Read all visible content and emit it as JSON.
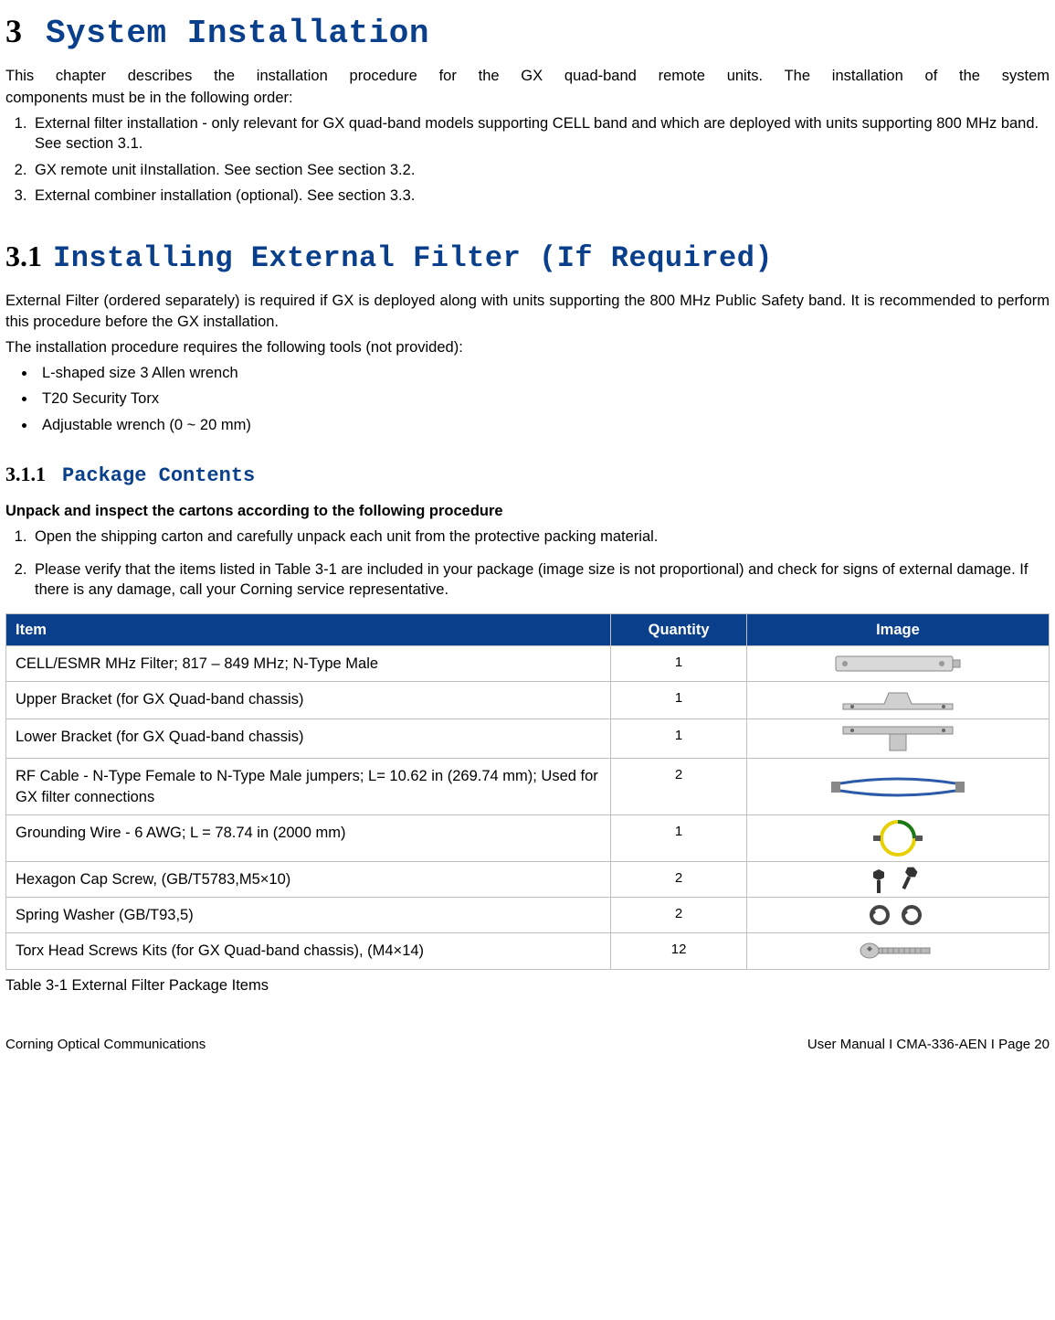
{
  "h1": {
    "num": "3",
    "title": "System Installation"
  },
  "intro_line1": "This  chapter  describes  the  installation  procedure  for  the  GX  quad-band  remote  units.  The  installation  of  the  system",
  "intro_line2": "components must be in the following order:",
  "steps_main": [
    "External filter installation - only relevant for GX quad-band models supporting CELL band and which are deployed with units supporting 800 MHz band. See section 3.1.",
    "GX remote unit iInstallation. See section See section 3.2.",
    "External combiner installation (optional). See section 3.3."
  ],
  "h2": {
    "num": "3.1",
    "title": "Installing External Filter (If Required)"
  },
  "h2_p1": "External Filter (ordered separately) is required if GX is deployed along with units supporting the 800 MHz Public Safety band. It is recommended to perform this procedure before the GX installation.",
  "h2_p2": "The installation procedure requires the following tools (not provided):",
  "tools": [
    "L-shaped size 3 Allen wrench",
    "T20 Security Torx",
    "Adjustable wrench (0 ~ 20 mm)"
  ],
  "h3": {
    "num": "3.1.1",
    "title": "Package Contents"
  },
  "h3_bold": "Unpack and inspect the cartons according to the following procedure",
  "pkg_steps": [
    "Open the shipping carton and carefully unpack each unit from the protective packing material.",
    "Please verify that the items listed in Table 3-1 are included in your package (image size is not proportional) and check for signs of external damage. If there is any damage, call your Corning service representative."
  ],
  "table": {
    "headers": {
      "item": "Item",
      "qty": "Quantity",
      "img": "Image"
    },
    "rows": [
      {
        "item": "CELL/ESMR MHz Filter; 817 – 849 MHz; N-Type Male",
        "qty": "1",
        "icon": "filter-box"
      },
      {
        "item": "Upper Bracket (for GX Quad-band chassis)",
        "qty": "1",
        "icon": "upper-bracket"
      },
      {
        "item": "Lower Bracket (for GX Quad-band chassis)",
        "qty": "1",
        "icon": "lower-bracket"
      },
      {
        "item": "RF Cable - N-Type Female to N-Type Male jumpers; L= 10.62 in (269.74 mm); Used for GX filter connections",
        "qty": "2",
        "icon": "rf-cable"
      },
      {
        "item": "Grounding Wire - 6 AWG; L = 78.74 in (2000 mm)",
        "qty": "1",
        "icon": "ground-wire"
      },
      {
        "item": "Hexagon Cap Screw, (GB/T5783,M5×10)",
        "qty": "2",
        "icon": "hex-screw"
      },
      {
        "item": "Spring Washer (GB/T93,5)",
        "qty": "2",
        "icon": "spring-washer"
      },
      {
        "item": "Torx Head Screws Kits (for GX Quad-band chassis), (M4×14)",
        "qty": "12",
        "icon": "torx-screw"
      }
    ]
  },
  "table_caption": "Table 3-1 External Filter Package Items",
  "footer": {
    "left": "Corning Optical Communications",
    "right": "User Manual I CMA-336-AEN I Page 20"
  }
}
